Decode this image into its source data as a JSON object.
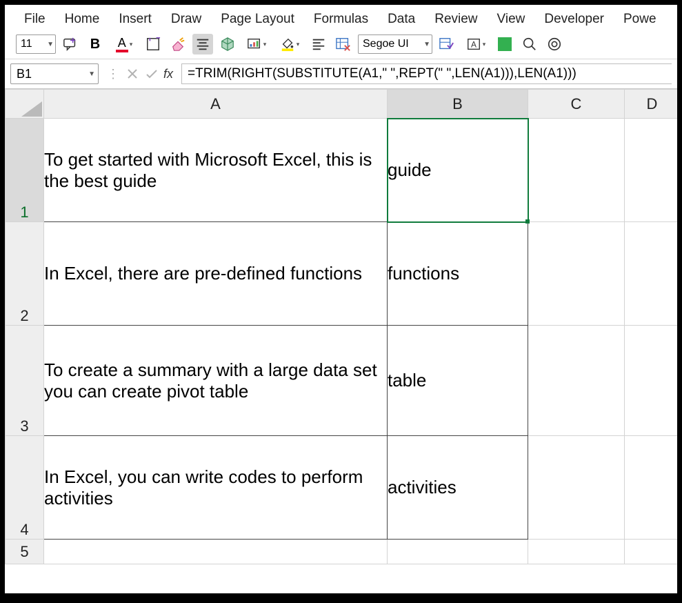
{
  "menu": {
    "items": [
      "File",
      "Home",
      "Insert",
      "Draw",
      "Page Layout",
      "Formulas",
      "Data",
      "Review",
      "View",
      "Developer",
      "Powe"
    ]
  },
  "toolbar": {
    "font_size": "11",
    "bold_label": "B",
    "font_color_label": "A",
    "font_name": "Segoe UI",
    "tb_box_label": "A"
  },
  "formula_bar": {
    "namebox": "B1",
    "fx_label": "fx",
    "formula": "=TRIM(RIGHT(SUBSTITUTE(A1,\" \",REPT(\" \",LEN(A1))),LEN(A1)))"
  },
  "grid": {
    "col_headers": [
      "A",
      "B",
      "C",
      "D"
    ],
    "rows": [
      {
        "num": "1",
        "a": "To get started with Microsoft Excel, this is the best guide",
        "b": "guide"
      },
      {
        "num": "2",
        "a": "In Excel, there are pre-defined functions",
        "b": "functions"
      },
      {
        "num": "3",
        "a": "To create a summary with a large data set you can create pivot table",
        "b": "table"
      },
      {
        "num": "4",
        "a": "In Excel, you can write codes to perform activities",
        "b": "activities"
      },
      {
        "num": "5",
        "a": "",
        "b": ""
      }
    ],
    "selected_cell": "B1"
  }
}
